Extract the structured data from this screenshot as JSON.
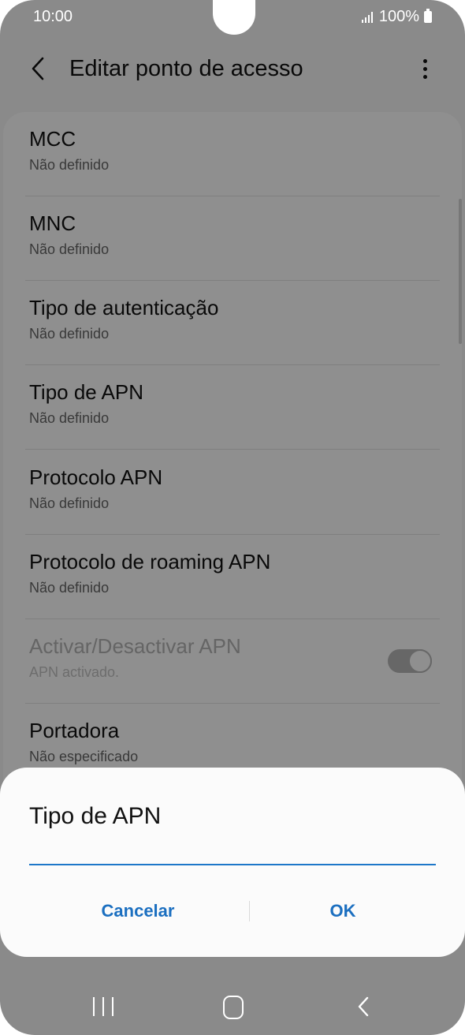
{
  "status_bar": {
    "time": "10:00",
    "battery": "100%"
  },
  "app_bar": {
    "title": "Editar ponto de acesso"
  },
  "settings": [
    {
      "title": "MCC",
      "value": "Não definido"
    },
    {
      "title": "MNC",
      "value": "Não definido"
    },
    {
      "title": "Tipo de autenticação",
      "value": "Não definido"
    },
    {
      "title": "Tipo de APN",
      "value": "Não definido"
    },
    {
      "title": "Protocolo APN",
      "value": "Não definido"
    },
    {
      "title": "Protocolo de roaming APN",
      "value": "Não definido"
    },
    {
      "title": "Activar/Desactivar APN",
      "value": "APN activado.",
      "toggle_on": true,
      "disabled": true
    },
    {
      "title": "Portadora",
      "value": "Não especificado"
    }
  ],
  "dialog": {
    "title": "Tipo de APN",
    "input_value": "",
    "cancel_label": "Cancelar",
    "ok_label": "OK"
  },
  "colors": {
    "accent": "#1b6fc0",
    "overlay": "rgba(0,0,0,0.44)"
  },
  "icons": {
    "back": "chevron-left-icon",
    "more": "more-vertical-icon",
    "nav_recent": "recent-apps-icon",
    "nav_home": "home-icon",
    "nav_back": "nav-back-icon"
  }
}
